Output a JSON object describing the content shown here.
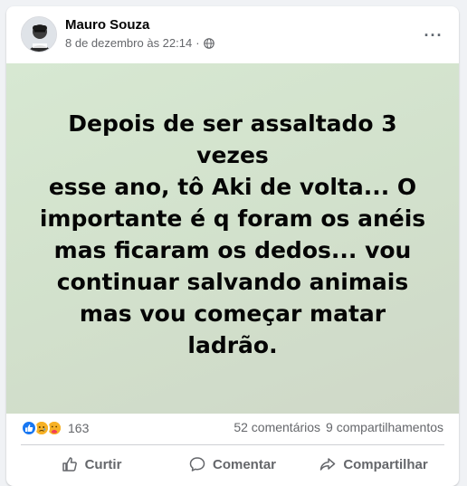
{
  "post": {
    "author": "Mauro Souza",
    "timestamp": "8 de dezembro às 22:14",
    "separator": "·",
    "privacy_icon": "globe-icon",
    "more_icon": "ellipsis-icon",
    "more_label": "···",
    "text": "Depois de ser assaltado 3 vezes\nesse ano, tô Aki de volta... O\nimportante é q foram os anéis\nmas ficaram os dedos... vou\ncontinuar salvando animais\nmas vou começar matar\nladrão.",
    "background_colors": [
      "#d7e8d2",
      "#cfd8c8"
    ]
  },
  "stats": {
    "reactions": [
      "like",
      "sad",
      "care"
    ],
    "reaction_count": "163",
    "comments": "52 comentários",
    "shares": "9 compartilhamentos"
  },
  "actions": {
    "like": "Curtir",
    "comment": "Comentar",
    "share": "Compartilhar"
  },
  "colors": {
    "primary_text": "#050505",
    "secondary_text": "#65676b",
    "like_blue": "#1877f2",
    "reaction_yellow": "#f7b125"
  }
}
